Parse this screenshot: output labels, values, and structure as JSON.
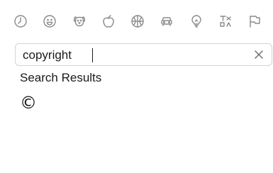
{
  "categories": [
    {
      "name": "recent",
      "icon": "clock-icon"
    },
    {
      "name": "smileys",
      "icon": "smiley-icon"
    },
    {
      "name": "animals",
      "icon": "dog-icon"
    },
    {
      "name": "food",
      "icon": "apple-icon"
    },
    {
      "name": "activity",
      "icon": "basketball-icon"
    },
    {
      "name": "travel",
      "icon": "car-icon"
    },
    {
      "name": "objects",
      "icon": "lightbulb-icon"
    },
    {
      "name": "symbols",
      "icon": "symbols-icon"
    },
    {
      "name": "flags",
      "icon": "flag-icon"
    }
  ],
  "search": {
    "value": "copyright",
    "clear_icon": "close-icon"
  },
  "results": {
    "title": "Search Results",
    "items": [
      "©"
    ]
  }
}
